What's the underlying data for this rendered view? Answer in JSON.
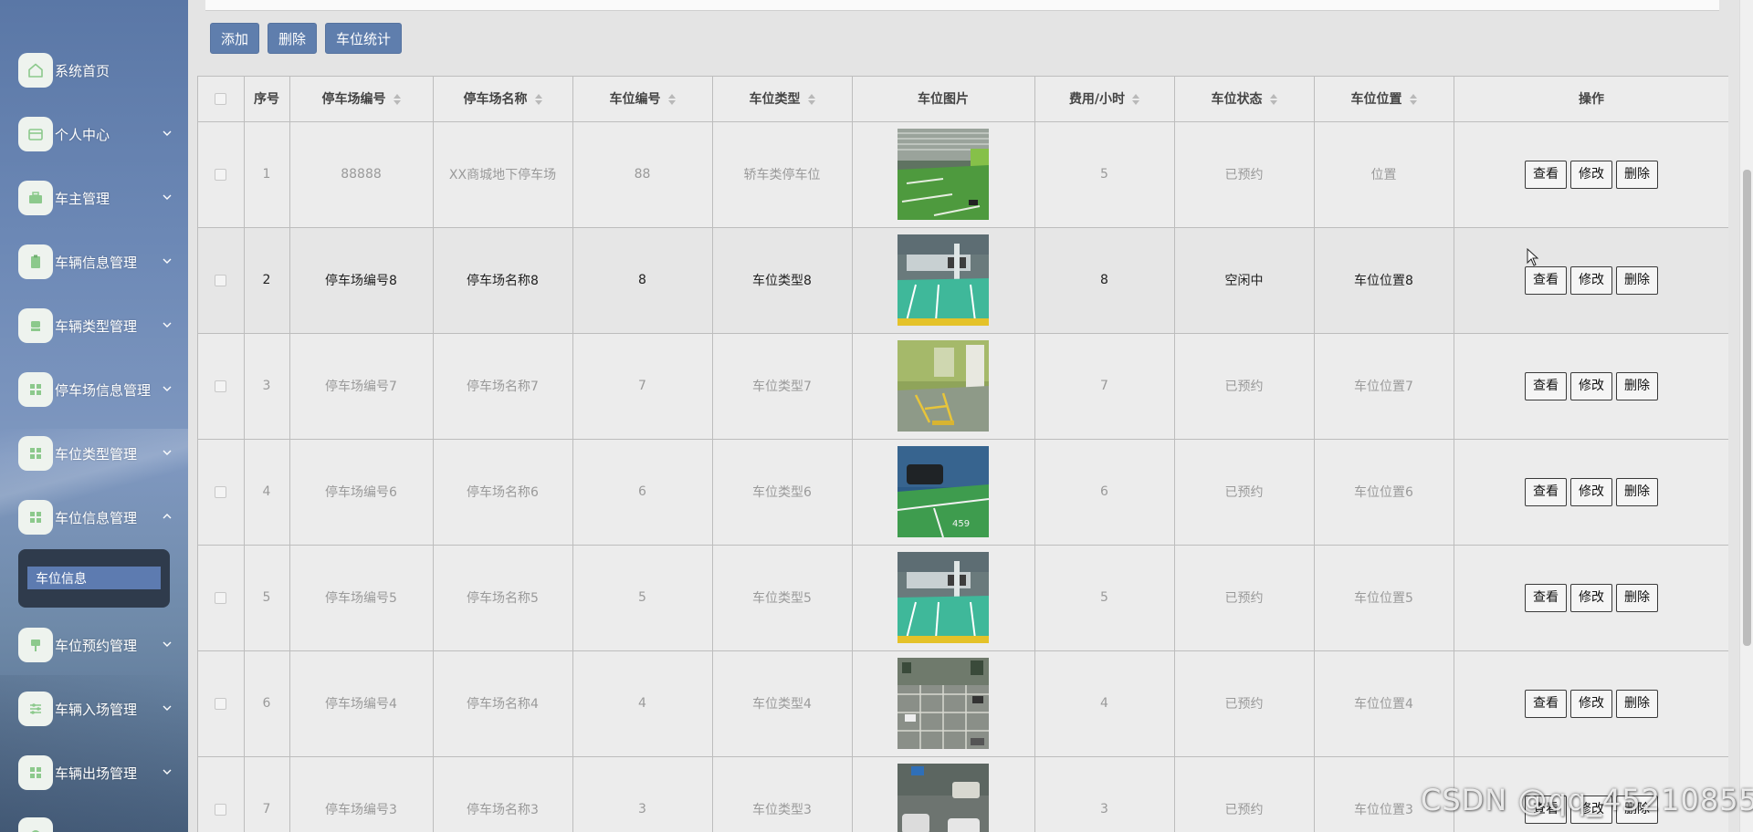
{
  "sidebar": {
    "items": [
      {
        "label": "系统首页",
        "icon": "home-icon",
        "has_caret": false
      },
      {
        "label": "个人中心",
        "icon": "wallet-icon",
        "has_caret": true
      },
      {
        "label": "车主管理",
        "icon": "briefcase-icon",
        "has_caret": true
      },
      {
        "label": "车辆信息管理",
        "icon": "clipboard-icon",
        "has_caret": true
      },
      {
        "label": "车辆类型管理",
        "icon": "seat-icon",
        "has_caret": true
      },
      {
        "label": "停车场信息管理",
        "icon": "grid-icon",
        "has_caret": true
      },
      {
        "label": "车位类型管理",
        "icon": "grid-icon",
        "has_caret": true
      },
      {
        "label": "车位信息管理",
        "icon": "grid-icon",
        "has_caret": true,
        "expanded": true
      },
      {
        "label": "车位预约管理",
        "icon": "sign-icon",
        "has_caret": true
      },
      {
        "label": "车辆入场管理",
        "icon": "sliders-icon",
        "has_caret": true
      },
      {
        "label": "车辆出场管理",
        "icon": "grid-icon",
        "has_caret": true
      }
    ],
    "submenu_active": "车位信息",
    "accent_color": "#5d7bb0"
  },
  "toolbar": {
    "add_label": "添加",
    "delete_label": "删除",
    "stats_label": "车位统计"
  },
  "table": {
    "headers": {
      "index": "序号",
      "lot_code": "停车场编号",
      "lot_name": "停车场名称",
      "space_code": "车位编号",
      "space_type": "车位类型",
      "space_image": "车位图片",
      "fee": "费用/小时",
      "status": "车位状态",
      "location": "车位位置",
      "actions": "操作"
    },
    "rows": [
      {
        "index": "1",
        "lot_code": "88888",
        "lot_name": "XX商城地下停车场",
        "space_code": "88",
        "space_type": "轿车类停车位",
        "image": "parking-photo-1",
        "fee": "5",
        "status": "已预约",
        "location": "位置"
      },
      {
        "index": "2",
        "lot_code": "停车场编号8",
        "lot_name": "停车场名称8",
        "space_code": "8",
        "space_type": "车位类型8",
        "image": "parking-photo-2",
        "fee": "8",
        "status": "空闲中",
        "location": "车位位置8"
      },
      {
        "index": "3",
        "lot_code": "停车场编号7",
        "lot_name": "停车场名称7",
        "space_code": "7",
        "space_type": "车位类型7",
        "image": "parking-photo-3",
        "fee": "7",
        "status": "已预约",
        "location": "车位位置7"
      },
      {
        "index": "4",
        "lot_code": "停车场编号6",
        "lot_name": "停车场名称6",
        "space_code": "6",
        "space_type": "车位类型6",
        "image": "parking-photo-4",
        "fee": "6",
        "status": "已预约",
        "location": "车位位置6"
      },
      {
        "index": "5",
        "lot_code": "停车场编号5",
        "lot_name": "停车场名称5",
        "space_code": "5",
        "space_type": "车位类型5",
        "image": "parking-photo-2",
        "fee": "5",
        "status": "已预约",
        "location": "车位位置5"
      },
      {
        "index": "6",
        "lot_code": "停车场编号4",
        "lot_name": "停车场名称4",
        "space_code": "4",
        "space_type": "车位类型4",
        "image": "parking-photo-5",
        "fee": "4",
        "status": "已预约",
        "location": "车位位置4"
      },
      {
        "index": "7",
        "lot_code": "停车场编号3",
        "lot_name": "停车场名称3",
        "space_code": "3",
        "space_type": "车位类型3",
        "image": "parking-photo-6",
        "fee": "3",
        "status": "已预约",
        "location": "车位位置3"
      }
    ],
    "actions": {
      "view": "查看",
      "edit": "修改",
      "delete": "删除"
    }
  },
  "watermark": "CSDN @qq_45210855"
}
